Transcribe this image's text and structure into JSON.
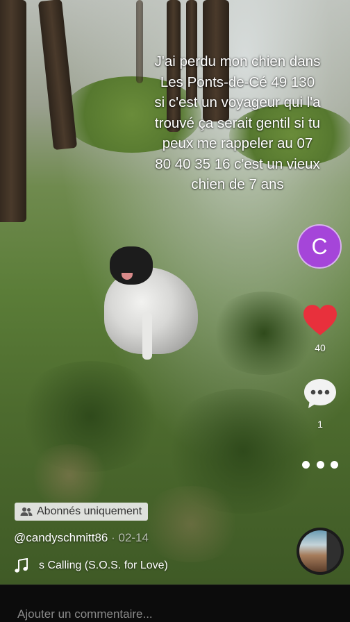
{
  "video": {
    "caption": "J'ai perdu mon chien dans Les Ponts-de-Cé 49 130 si c'est un voyageur qui l'a trouvé ça serait gentil si tu peux me rappeler au 07 80 40 35 16 c'est un vieux chien de 7 ans"
  },
  "sidebar": {
    "creator_initial": "C",
    "likes": "40",
    "comments": "1",
    "heart_color": "#e8303c",
    "avatar_color": "#a545d9"
  },
  "post": {
    "audience_badge": "Abonnés uniquement",
    "username": "@candyschmitt86",
    "date": "02-14",
    "sound": "s Calling (S.O.S. for Love)"
  },
  "comment": {
    "placeholder": "Ajouter un commentaire..."
  }
}
